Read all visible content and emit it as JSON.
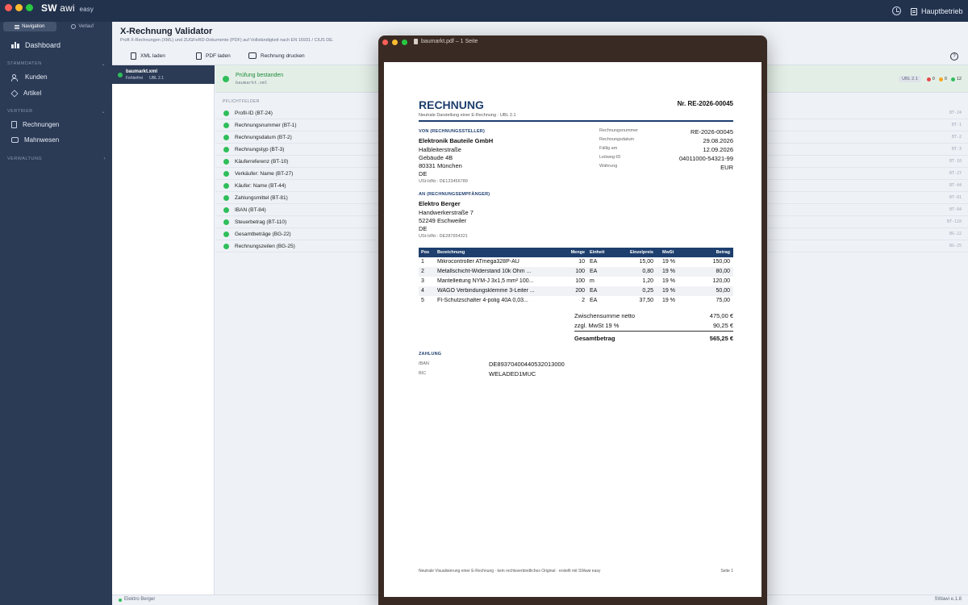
{
  "titlebar": {
    "brand_a": "SW",
    "brand_b": "awi",
    "brand_c": "easy",
    "site": "Hauptbetrieb"
  },
  "sidebar": {
    "segments": [
      {
        "label": "Navigation"
      },
      {
        "label": "Verlauf"
      }
    ],
    "dashboard": "Dashboard",
    "sections": {
      "stammdaten": {
        "title": "STAMMDATEN",
        "items": [
          "Kunden",
          "Artikel"
        ]
      },
      "vertrieb": {
        "title": "VERTRIEB",
        "items": [
          "Rechnungen",
          "Mahnwesen"
        ]
      },
      "verwaltung": {
        "title": "VERWALTUNG"
      }
    }
  },
  "header": {
    "title": "X-Rechnung Validator",
    "subtitle": "Prüft X-Rechnungen (XML) und ZUGFeRD-Dokumente (PDF) auf Vollständigkeit nach EN 16931 / CIUS DE.",
    "buttons": {
      "xml": "XML laden",
      "pdf": "PDF laden",
      "print": "Rechnung drucken"
    }
  },
  "file": {
    "name": "baumarkt.xml",
    "status": "Fehlerfrei",
    "format": "UBL 2.1"
  },
  "result": {
    "title": "Prüfung bestanden",
    "file": "baumarkt.xml",
    "format": "UBL 2.1",
    "errors": "0",
    "warnings": "0",
    "ok": "12"
  },
  "checks": {
    "section": "PFLICHTFELDER",
    "items": [
      {
        "label": "Profil-ID (BT-24)",
        "code": "BT-24"
      },
      {
        "label": "Rechnungsnummer (BT-1)",
        "code": "BT-1"
      },
      {
        "label": "Rechnungsdatum (BT-2)",
        "code": "BT-2"
      },
      {
        "label": "Rechnungstyp (BT-3)",
        "code": "BT-3"
      },
      {
        "label": "Käuferreferenz (BT-10)",
        "code": "BT-10"
      },
      {
        "label": "Verkäufer: Name (BT-27)",
        "code": "BT-27"
      },
      {
        "label": "Käufer: Name (BT-44)",
        "code": "BT-44"
      },
      {
        "label": "Zahlungsmittel (BT-81)",
        "code": "BT-81"
      },
      {
        "label": "IBAN (BT-84)",
        "code": "BT-84"
      },
      {
        "label": "Steuerbetrag (BT-110)",
        "code": "BT-110"
      },
      {
        "label": "Gesamtbeträge (BG-22)",
        "code": "BG-22"
      },
      {
        "label": "Rechnungszeilen (BG-25)",
        "code": "BG-25"
      }
    ]
  },
  "statusbar": {
    "left": "Elektro Berger",
    "right": "SWawi e.1.8"
  },
  "pdf": {
    "window_title": "baumarkt.pdf – 1 Seite",
    "title": "RECHNUNG",
    "number": "Nr. RE-2026-00045",
    "subtitle": "Neutrale Darstellung einer E-Rechnung · UBL 2.1",
    "seller": {
      "header": "VON (RECHNUNGSSTELLER)",
      "name": "Elektronik Bauteile GmbH",
      "street": "Halbleiterstraße",
      "building": "Gebäude 4B",
      "city": "80331 München",
      "country": "DE",
      "vat": "USt-IdNr.: DE123456789"
    },
    "meta": [
      {
        "k": "Rechnungsnummer",
        "v": "RE-2026-00045"
      },
      {
        "k": "Rechnungsdatum",
        "v": "29.08.2026"
      },
      {
        "k": "Fällig am",
        "v": "12.09.2026"
      },
      {
        "k": "Leitweg-ID",
        "v": "04011000-54321-99"
      },
      {
        "k": "Währung",
        "v": "EUR"
      }
    ],
    "buyer": {
      "header": "AN (RECHNUNGSEMPFÄNGER)",
      "name": "Elektro Berger",
      "street": "Handwerkerstraße 7",
      "city": "52249 Eschweiler",
      "country": "DE",
      "vat": "USt-IdNr.: DE287654321"
    },
    "table": {
      "headers": {
        "pos": "Pos",
        "bez": "Bezeichnung",
        "men": "Menge",
        "ein": "Einheit",
        "ep": "Einzelpreis",
        "mw": "MwSt",
        "bt": "Betrag"
      },
      "rows": [
        {
          "pos": "1",
          "bez": "Mikrocontroller ATmega328P-AU",
          "men": "10",
          "ein": "EA",
          "ep": "15,00",
          "mw": "19 %",
          "bt": "150,00"
        },
        {
          "pos": "2",
          "bez": "Metallschicht-Widerstand 10k Ohm ...",
          "men": "100",
          "ein": "EA",
          "ep": "0,80",
          "mw": "19 %",
          "bt": "80,00"
        },
        {
          "pos": "3",
          "bez": "Mantelleitung NYM-J 3x1,5 mm² 100...",
          "men": "100",
          "ein": "m",
          "ep": "1,20",
          "mw": "19 %",
          "bt": "120,00"
        },
        {
          "pos": "4",
          "bez": "WAGO Verbindungsklemme 3-Leiter ...",
          "men": "200",
          "ein": "EA",
          "ep": "0,25",
          "mw": "19 %",
          "bt": "50,00"
        },
        {
          "pos": "5",
          "bez": "FI-Schutzschalter 4-polig 40A 0,03...",
          "men": "2",
          "ein": "EA",
          "ep": "37,50",
          "mw": "19 %",
          "bt": "75,00"
        }
      ]
    },
    "totals": {
      "net_label": "Zwischensumme netto",
      "net": "475,00 €",
      "vat_label": "zzgl. MwSt 19 %",
      "vat": "90,25 €",
      "gross_label": "Gesamtbetrag",
      "gross": "565,25 €"
    },
    "payment": {
      "header": "ZAHLUNG",
      "iban_label": "IBAN",
      "iban": "DE89370400440532013000",
      "bic_label": "BIC",
      "bic": "WELADED1MUC"
    },
    "footer": {
      "left": "Neutrale Visualisierung einer E-Rechnung · kein rechtsverbindliches Original · erstellt mit SWawi easy",
      "right": "Seite 1"
    }
  }
}
